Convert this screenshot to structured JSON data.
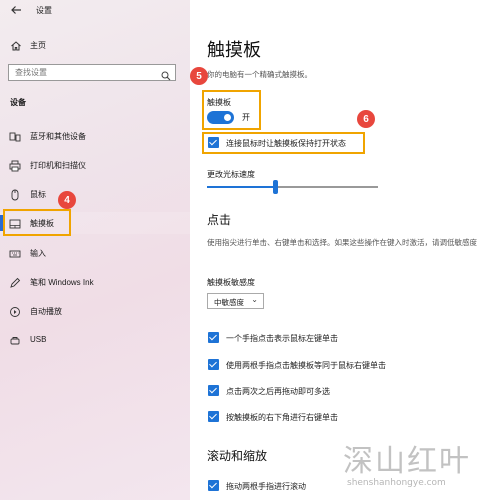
{
  "window": {
    "title": "设置"
  },
  "sidebar": {
    "home": "主页",
    "search_placeholder": "查找设置",
    "section": "设备",
    "items": [
      {
        "label": "蓝牙和其他设备",
        "icon": "bluetooth-devices-icon"
      },
      {
        "label": "打印机和扫描仪",
        "icon": "printer-icon"
      },
      {
        "label": "鼠标",
        "icon": "mouse-icon"
      },
      {
        "label": "触摸板",
        "icon": "touchpad-icon",
        "selected": true
      },
      {
        "label": "输入",
        "icon": "keyboard-icon"
      },
      {
        "label": "笔和 Windows Ink",
        "icon": "pen-icon"
      },
      {
        "label": "自动播放",
        "icon": "autoplay-icon"
      },
      {
        "label": "USB",
        "icon": "usb-icon"
      }
    ]
  },
  "main": {
    "title": "触摸板",
    "intro": "你的电脑有一个精确式触摸板。",
    "touchpad_label": "触摸板",
    "toggle_state": "开",
    "keep_on_mouse": "连接鼠标时让触摸板保持打开状态",
    "speed_label": "更改光标速度",
    "speed_value": 0.4,
    "taps_heading": "点击",
    "taps_desc": "使用指尖进行单击、右键单击和选择。如果这些操作在键入时激活，请调低敏感度",
    "sensitivity_label": "触摸板敏感度",
    "sensitivity_value": "中敏感度",
    "tap_options": [
      "一个手指点击表示鼠标左键单击",
      "使用两根手指点击触摸板等同于鼠标右键单击",
      "点击两次之后再拖动即可多选",
      "按触摸板的右下角进行右键单击"
    ],
    "scroll_heading": "滚动和缩放",
    "scroll_option": "拖动两根手指进行滚动"
  },
  "annotations": {
    "n4": "4",
    "n5": "5",
    "n6": "6"
  },
  "watermark": {
    "cn": "深山红叶",
    "en": "shenshanhongye.com"
  },
  "colors": {
    "accent": "#1e73d6",
    "annotation_box": "#f0a400",
    "annotation_circle": "#e8473d"
  }
}
